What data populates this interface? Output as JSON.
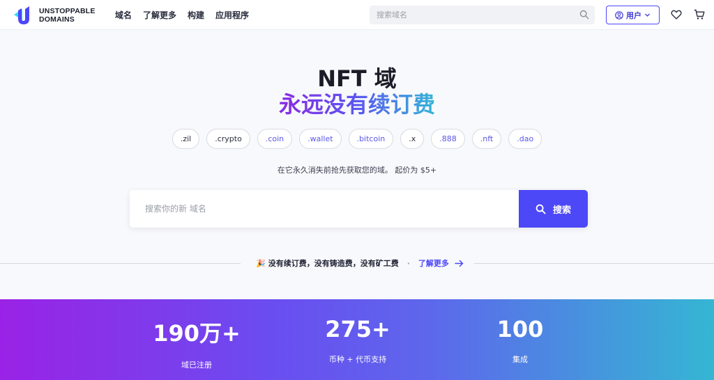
{
  "brand": {
    "name": "UNSTOPPABLE\nDOMAINS"
  },
  "nav": [
    "域名",
    "了解更多",
    "构建",
    "应用程序"
  ],
  "header_search": {
    "placeholder": "搜索域名"
  },
  "user_button": {
    "label": "用户"
  },
  "hero": {
    "title_line1": "NFT 域",
    "title_line2": "永远没有续订费",
    "tlds": [
      ".zil",
      ".crypto",
      ".coin",
      ".wallet",
      ".bitcoin",
      ".x",
      ".888",
      ".nft",
      ".dao"
    ],
    "subline": "在它永久消失前抢先获取您的域。 起价为 $5+"
  },
  "main_search": {
    "placeholder": "搜索你的新 域名",
    "button_label": "搜索"
  },
  "promo": {
    "emoji": "🎉",
    "text": "没有续订费，没有铸造费，没有矿工费",
    "separator": "·",
    "link": "了解更多"
  },
  "stats": [
    {
      "value": "190万+",
      "label": "域已注册"
    },
    {
      "value": "275+",
      "label": "币种 + 代币支持"
    },
    {
      "value": "100",
      "label": "集成"
    }
  ],
  "colors": {
    "accent": "#4c47f7",
    "gradient_start": "#9a22e6",
    "gradient_end": "#35b6d3"
  }
}
